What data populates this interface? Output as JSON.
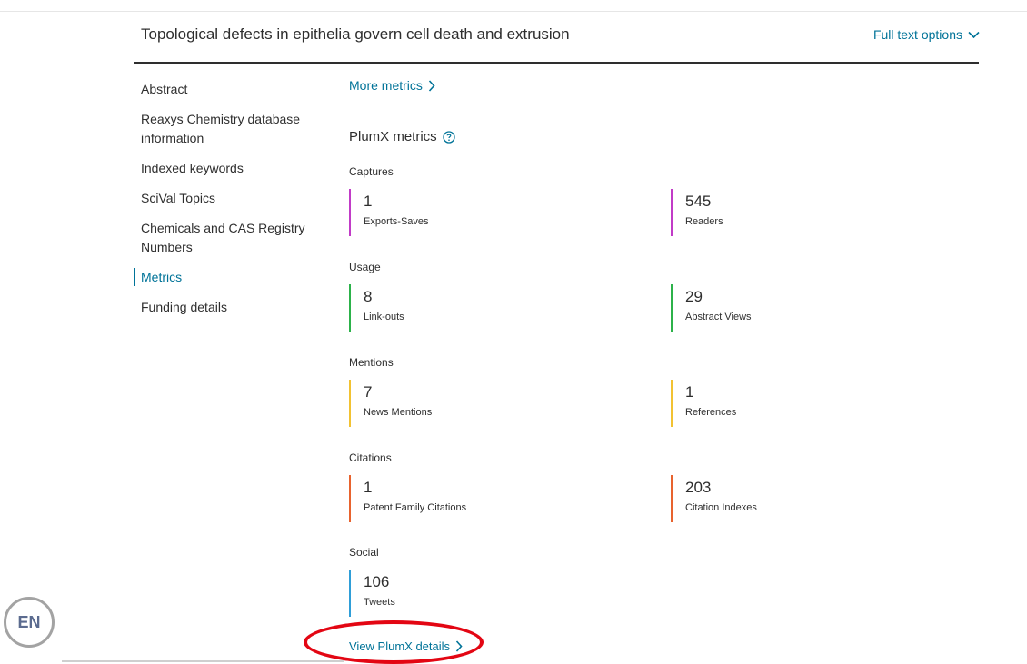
{
  "header": {
    "title": "Topological defects in epithelia govern cell death and extrusion",
    "full_text_options": "Full text options"
  },
  "sidebar": {
    "items": [
      {
        "label": "Abstract"
      },
      {
        "label": "Reaxys Chemistry database information"
      },
      {
        "label": "Indexed keywords"
      },
      {
        "label": "SciVal Topics"
      },
      {
        "label": "Chemicals and CAS Registry Numbers"
      },
      {
        "label": "Metrics",
        "active": true
      },
      {
        "label": "Funding details"
      }
    ]
  },
  "metrics": {
    "more_metrics": "More metrics",
    "plumx_title": "PlumX metrics",
    "categories": [
      {
        "name": "Captures",
        "color": "#c13bc7",
        "items": [
          {
            "value": "1",
            "label": "Exports-Saves"
          },
          {
            "value": "545",
            "label": "Readers"
          }
        ]
      },
      {
        "name": "Usage",
        "color": "#2cb24a",
        "items": [
          {
            "value": "8",
            "label": "Link-outs"
          },
          {
            "value": "29",
            "label": "Abstract Views"
          }
        ]
      },
      {
        "name": "Mentions",
        "color": "#f2c232",
        "items": [
          {
            "value": "7",
            "label": "News Mentions"
          },
          {
            "value": "1",
            "label": "References"
          }
        ]
      },
      {
        "name": "Citations",
        "color": "#e8632e",
        "items": [
          {
            "value": "1",
            "label": "Patent Family Citations"
          },
          {
            "value": "203",
            "label": "Citation Indexes"
          }
        ]
      },
      {
        "name": "Social",
        "color": "#2f9ed8",
        "items": [
          {
            "value": "106",
            "label": "Tweets"
          }
        ]
      }
    ],
    "view_details": "View PlumX details"
  },
  "language_badge": "EN",
  "colors": {
    "link": "#007398",
    "highlight": "#e30613"
  }
}
